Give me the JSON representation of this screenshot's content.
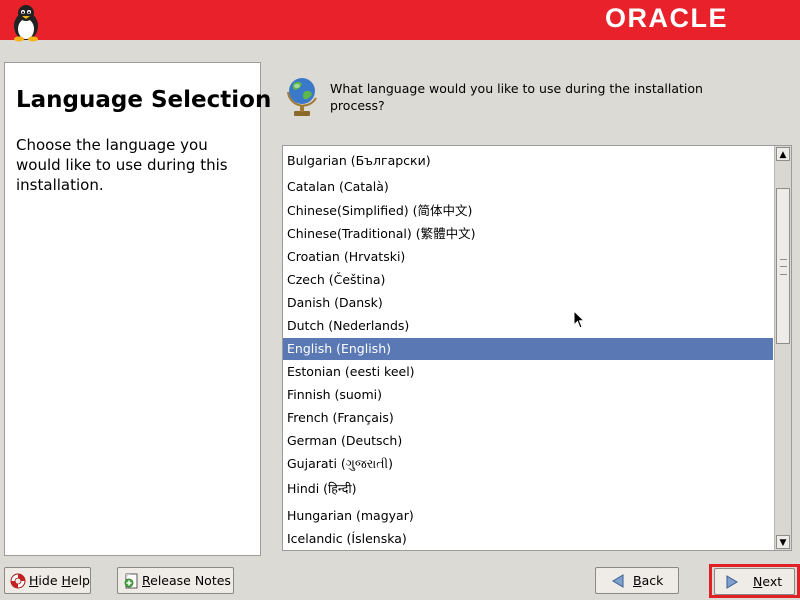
{
  "header": {
    "brand": "ORACLE"
  },
  "help": {
    "title": "Language Selection",
    "text": "Choose the language you would like to use during this installation."
  },
  "question": "What language would you like to use during the installation process?",
  "languages": [
    "Bulgarian (Български)",
    "Catalan (Català)",
    "Chinese(Simplified) (简体中文)",
    "Chinese(Traditional) (繁體中文)",
    "Croatian (Hrvatski)",
    "Czech (Čeština)",
    "Danish (Dansk)",
    "Dutch (Nederlands)",
    "English (English)",
    "Estonian (eesti keel)",
    "Finnish (suomi)",
    "French (Français)",
    "German (Deutsch)",
    "Gujarati (ગુજરાતી)",
    "Hindi (हिन्दी)",
    "Hungarian (magyar)",
    "Icelandic (Íslenska)"
  ],
  "selected_language": "English (English)",
  "buttons": {
    "hide_help": {
      "mnemonic": "H",
      "rest": "ide ",
      "mnemonic2": "H",
      "rest2": "elp"
    },
    "release_notes": {
      "mnemonic": "R",
      "rest": "elease Notes"
    },
    "back": {
      "mnemonic": "B",
      "rest": "ack"
    },
    "next": {
      "mnemonic": "N",
      "rest": "ext"
    }
  },
  "colors": {
    "header": "#e8212b",
    "selection": "#5a79b4",
    "focus_frame": "#e22127"
  },
  "icons": {
    "header": "tux-penguin-icon",
    "question": "globe-icon",
    "hide_help": "lifebuoy-icon",
    "release_notes": "notes-icon",
    "back": "back-arrow-icon",
    "next": "next-arrow-icon"
  }
}
